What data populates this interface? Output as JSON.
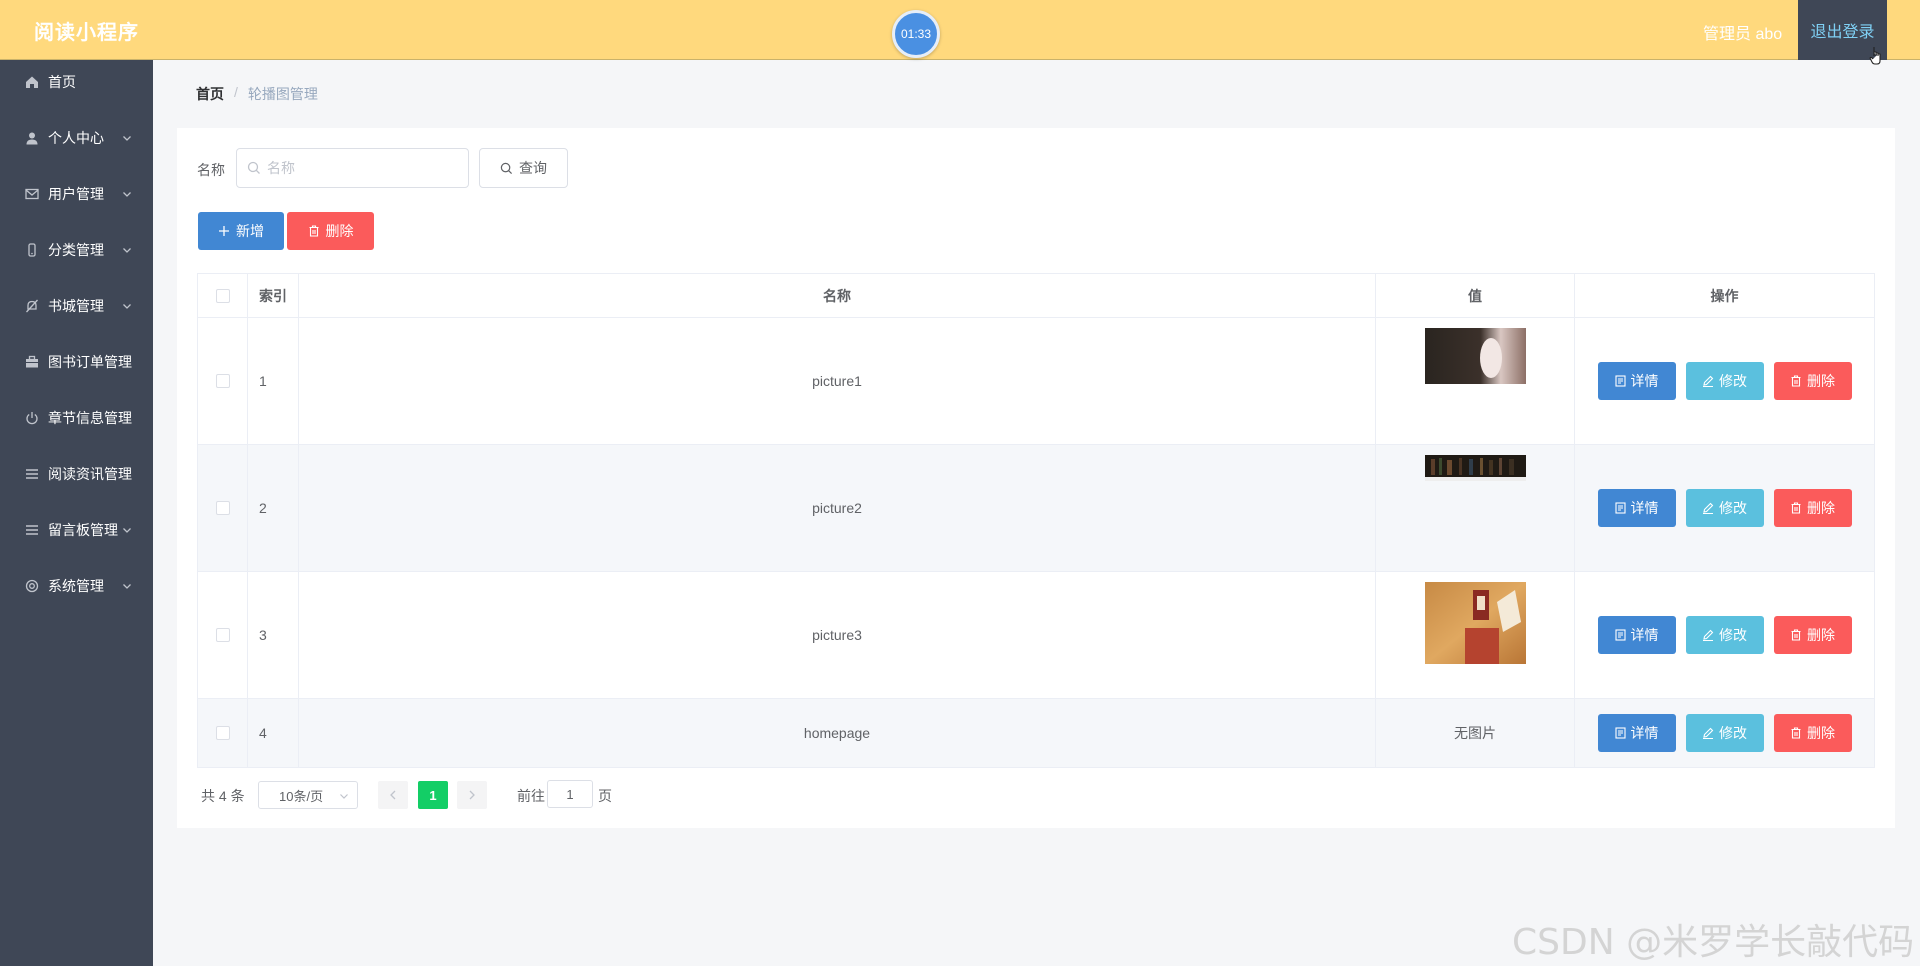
{
  "header": {
    "app_title": "阅读小程序",
    "timer": "01:33",
    "admin_label": "管理员 abo",
    "logout_label": "退出登录",
    "bg_color": "#ffd97d"
  },
  "sidebar": {
    "items": [
      {
        "label": "首页",
        "icon": "home-icon",
        "has_children": false
      },
      {
        "label": "个人中心",
        "icon": "user-icon",
        "has_children": true
      },
      {
        "label": "用户管理",
        "icon": "mail-icon",
        "has_children": true
      },
      {
        "label": "分类管理",
        "icon": "phone-icon",
        "has_children": true
      },
      {
        "label": "书城管理",
        "icon": "bell-off-icon",
        "has_children": true
      },
      {
        "label": "图书订单管理",
        "icon": "briefcase-icon",
        "has_children": false
      },
      {
        "label": "章节信息管理",
        "icon": "power-icon",
        "has_children": false
      },
      {
        "label": "阅读资讯管理",
        "icon": "menu-icon",
        "has_children": false
      },
      {
        "label": "留言板管理",
        "icon": "menu-icon",
        "has_children": true
      },
      {
        "label": "系统管理",
        "icon": "settings-icon",
        "has_children": true
      }
    ]
  },
  "breadcrumb": {
    "home": "首页",
    "separator": "/",
    "current": "轮播图管理"
  },
  "search": {
    "label": "名称",
    "placeholder": "名称",
    "value": "",
    "query_label": "查询"
  },
  "actions": {
    "add_label": "新增",
    "delete_label": "删除"
  },
  "table": {
    "headers": {
      "index": "索引",
      "name": "名称",
      "value": "值",
      "ops": "操作"
    },
    "rows": [
      {
        "index": "1",
        "name": "picture1",
        "value": "",
        "has_image": true
      },
      {
        "index": "2",
        "name": "picture2",
        "value": "",
        "has_image": true
      },
      {
        "index": "3",
        "name": "picture3",
        "value": "",
        "has_image": true
      },
      {
        "index": "4",
        "name": "homepage",
        "value": "无图片",
        "has_image": false
      }
    ],
    "op_labels": {
      "detail": "详情",
      "edit": "修改",
      "delete": "删除"
    }
  },
  "pagination": {
    "total": "共 4 条",
    "page_size": "10条/页",
    "current_page": "1",
    "goto_label": "前往",
    "goto_value": "1",
    "page_suffix": "页"
  },
  "watermark": "CSDN @米罗学长敲代码",
  "colors": {
    "primary": "#4187d3",
    "info": "#5bc0de",
    "danger": "#fb5b5b",
    "success": "#13ce66",
    "sidebar": "#3f4756"
  }
}
